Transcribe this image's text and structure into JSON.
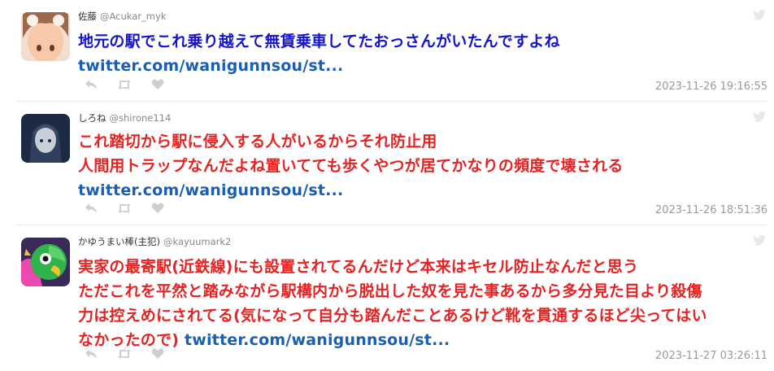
{
  "tweets": [
    {
      "display_name": "佐藤",
      "screen_name": "@Acukar_myk",
      "text_lines": [
        "地元の駅でこれ乗り越えて無賃乗車してたおっさんがいたんですよね"
      ],
      "link_text": "twitter.com/wanigunnsou/st...",
      "timestamp": "2023-11-26 19:16:55",
      "text_color": "#1414c8"
    },
    {
      "display_name": "しろね",
      "screen_name": "@shirone114",
      "text_lines": [
        "これ踏切から駅に侵入する人がいるからそれ防止用",
        "人間用トラップなんだよね置いてても歩くやつが居てかなりの頻度で壊される"
      ],
      "link_text": "twitter.com/wanigunnsou/st...",
      "timestamp": "2023-11-26 18:51:36",
      "text_color": "#e62323"
    },
    {
      "display_name": "かゆうまい棒(主犯)",
      "screen_name": "@kayuumark2",
      "text_lines": [
        "実家の最寄駅(近鉄線)にも設置されてるんだけど本来はキセル防止なんだと思う",
        "ただこれを平然と踏みながら駅構内から脱出した奴を見た事あるから多分見た目より殺傷",
        "力は控えめにされてる(気になって自分も踏んだことあるけど靴を貫通するほど尖ってはい",
        "なかったので)"
      ],
      "link_text": "twitter.com/wanigunnsou/st...",
      "timestamp": "2023-11-27 03:26:11",
      "text_color": "#e62323"
    }
  ],
  "icons": {
    "reply": "reply-icon",
    "retweet": "retweet-icon",
    "like": "heart-icon",
    "brand": "twitter-bird-icon"
  },
  "colors": {
    "link": "#1a5fb4",
    "action_icon": "#cfcfcf",
    "timestamp": "#9a9a9a"
  }
}
